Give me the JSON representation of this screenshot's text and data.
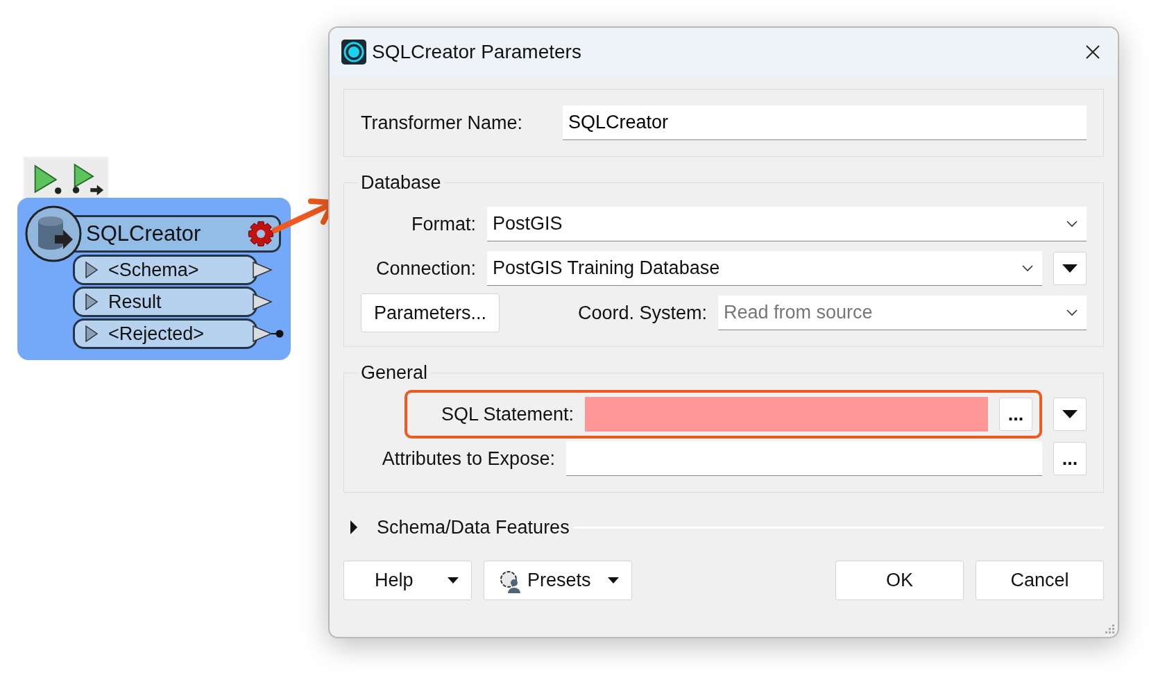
{
  "node": {
    "title": "SQLCreator",
    "ports": [
      {
        "label": "<Schema>",
        "connected": false
      },
      {
        "label": "Result",
        "connected": false
      },
      {
        "label": "<Rejected>",
        "connected": true
      }
    ]
  },
  "dialog": {
    "title": "SQLCreator Parameters",
    "transformer_name": {
      "label": "Transformer Name:",
      "value": "SQLCreator"
    },
    "database": {
      "title": "Database",
      "format": {
        "label": "Format:",
        "value": "PostGIS"
      },
      "connection": {
        "label": "Connection:",
        "value": "PostGIS Training Database"
      },
      "parameters_button": "Parameters...",
      "coord_system": {
        "label": "Coord. System:",
        "placeholder": "Read from source"
      }
    },
    "general": {
      "title": "General",
      "sql_statement": {
        "label": "SQL Statement:",
        "invalid": true,
        "highlighted": true,
        "browse": "..."
      },
      "attributes_to_expose": {
        "label": "Attributes to Expose:",
        "browse": "..."
      }
    },
    "schema_section": {
      "title": "Schema/Data Features",
      "expanded": false
    },
    "buttons": [
      {
        "label": "Help",
        "kind": "menu"
      },
      {
        "label": "Presets",
        "kind": "presets"
      },
      {
        "label": "OK",
        "kind": "plain"
      },
      {
        "label": "Cancel",
        "kind": "plain"
      }
    ]
  }
}
